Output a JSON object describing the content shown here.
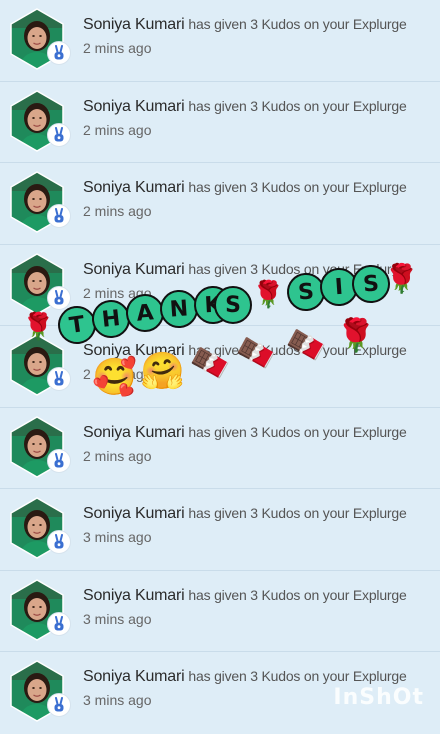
{
  "notifications": [
    {
      "name": "Soniya Kumari",
      "message": "has given 3 Kudos on your Explurge",
      "time": "2 mins ago"
    },
    {
      "name": "Soniya Kumari",
      "message": "has given 3 Kudos on your Explurge",
      "time": "2 mins ago"
    },
    {
      "name": "Soniya Kumari",
      "message": "has given 3 Kudos on your Explurge",
      "time": "2 mins ago"
    },
    {
      "name": "Soniya Kumari",
      "message": "has given 3 Kudos on your Explurge",
      "time": "2 mins ago"
    },
    {
      "name": "Soniya Kumari",
      "message": "has given 3 Kudos on your Explurge",
      "time": "2 mins ago"
    },
    {
      "name": "Soniya Kumari",
      "message": "has given 3 Kudos on your Explurge",
      "time": "2 mins ago"
    },
    {
      "name": "Soniya Kumari",
      "message": "has given 3 Kudos on your Explurge",
      "time": "3 mins ago"
    },
    {
      "name": "Soniya Kumari",
      "message": "has given 3 Kudos on your Explurge",
      "time": "3 mins ago"
    },
    {
      "name": "Soniya Kumari",
      "message": "has given 3 Kudos on your Explurge",
      "time": "3 mins ago"
    }
  ],
  "sticker": {
    "letters": [
      "T",
      "H",
      "A",
      "N",
      "K",
      "S",
      "S",
      "I",
      "S"
    ],
    "emojis": {
      "rose": "🌹",
      "hug": "🤗",
      "smile_hearts": "🥰",
      "chocolate": "🍫"
    }
  },
  "badge_icon": "kudos-hand-icon",
  "colors": {
    "background": "#dcecf6",
    "bubble": "#2ec48f",
    "badge_icon": "#3b6fd1"
  },
  "watermark": "InShOt"
}
